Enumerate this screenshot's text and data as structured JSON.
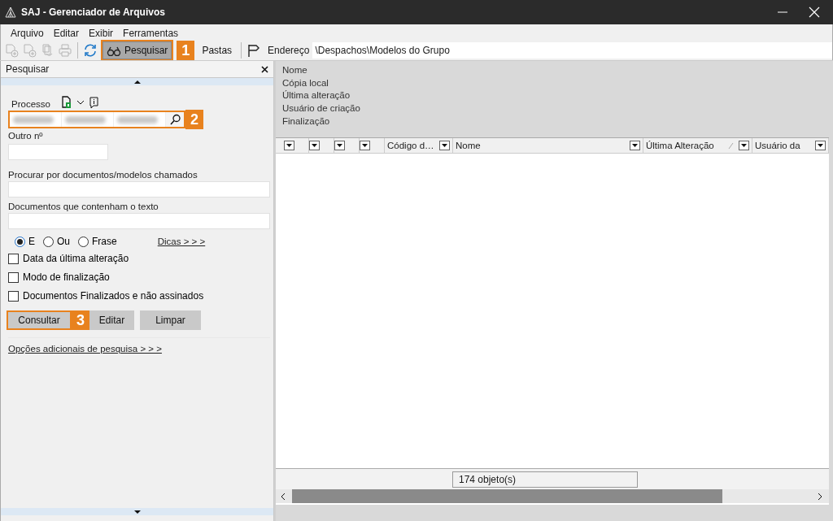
{
  "window": {
    "title": "SAJ - Gerenciador de Arquivos"
  },
  "menu": [
    "Arquivo",
    "Editar",
    "Exibir",
    "Ferramentas"
  ],
  "toolbar": {
    "buttons": [
      {
        "kind": "icon",
        "disabled": true
      },
      {
        "kind": "icon",
        "disabled": true
      },
      {
        "kind": "icon",
        "disabled": true
      },
      {
        "kind": "icon",
        "disabled": true
      },
      {
        "kind": "icon",
        "disabled": false
      },
      {
        "kind": "text",
        "label": "Pesquisar",
        "selected": true,
        "callout": "1"
      },
      {
        "kind": "text",
        "label": "Pastas",
        "selected": false
      }
    ],
    "address_label": "Endereço",
    "address": "\\Despachos\\Modelos do Grupo"
  },
  "search_panel": {
    "title": "Pesquisar",
    "process": {
      "label": "Processo",
      "callout": "2"
    },
    "other_number": {
      "label": "Outro nº"
    },
    "name_field": {
      "label": "Procurar por documentos/modelos chamados"
    },
    "text_field": {
      "label": "Documentos que contenham o texto"
    },
    "match_modes": [
      {
        "label": "E",
        "selected": true
      },
      {
        "label": "Ou",
        "selected": false
      },
      {
        "label": "Frase",
        "selected": false
      }
    ],
    "tips_link": "Dicas > > >",
    "filters": [
      {
        "label": "Data da última alteração",
        "checked": false
      },
      {
        "label": "Modo de finalização",
        "checked": false
      },
      {
        "label": "Documentos Finalizados e não assinados",
        "checked": false
      }
    ],
    "buttons": [
      {
        "label": "Consultar",
        "callout": "3"
      },
      {
        "label": "Editar"
      },
      {
        "label": "Limpar"
      }
    ],
    "more_link": "Opções adicionais de pesquisa > > >"
  },
  "details": [
    "Nome",
    "Cópia local",
    "Última alteração",
    "Usuário de criação",
    "Finalização"
  ],
  "table": {
    "columns": [
      {
        "sorted": false
      },
      {
        "sorted": false
      },
      {
        "sorted": false
      },
      {
        "sorted": false
      },
      {
        "label": "Código d…",
        "sorted": false
      },
      {
        "label": "Nome",
        "sorted": false
      },
      {
        "label": "Última Alteração",
        "sorted": true
      },
      {
        "label": "Usuário da",
        "sorted": false
      }
    ]
  },
  "status_bar": {
    "count": "174 objeto(s)"
  }
}
